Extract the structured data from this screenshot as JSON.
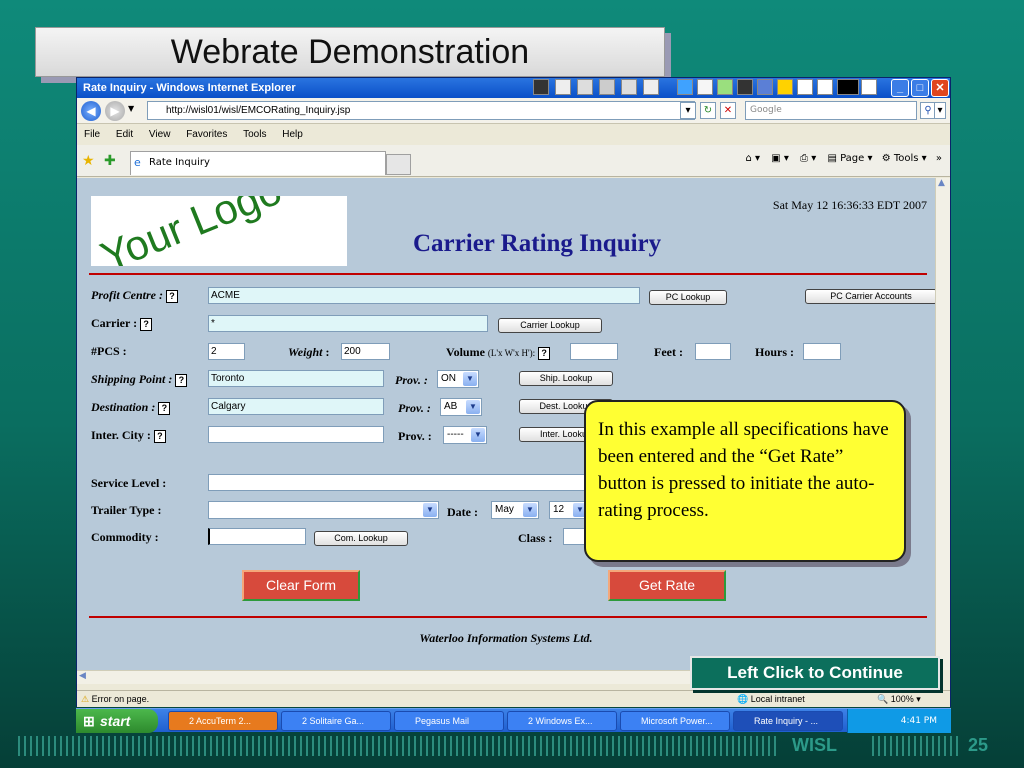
{
  "slide": {
    "title": "Webrate Demonstration",
    "footer_label": "WISL",
    "page_number": "25",
    "continue_label": "Left Click to Continue",
    "callout_text": "In this example all specifications have been entered and the “Get Rate” button is pressed to initiate the auto-rating process."
  },
  "browser": {
    "window_title": "Rate Inquiry - Windows Internet Explorer",
    "url": "http://wisl01/wisl/EMCORating_Inquiry.jsp",
    "search_placeholder": "Google",
    "menu": [
      "File",
      "Edit",
      "View",
      "Favorites",
      "Tools",
      "Help"
    ],
    "tab_label": "Rate Inquiry",
    "page_cmd_label": "Page",
    "tools_cmd_label": "Tools",
    "status_left": "Error on page.",
    "status_zone": "Local intranet",
    "status_zoom": "100%"
  },
  "page": {
    "logo_text": "Your Logo",
    "date": "Sat May 12 16:36:33 EDT 2007",
    "heading": "Carrier Rating Inquiry",
    "footer": "Waterloo Information Systems Ltd.",
    "labels": {
      "profit_centre": "Profit Centre :",
      "carrier": "Carrier :",
      "pcs": "#PCS :",
      "weight": "Weight",
      "volume": "Volume",
      "volume_hint": "(L'x W'x H'):",
      "feet": "Feet :",
      "hours": "Hours :",
      "shipping_point": "Shipping Point :",
      "prov": "Prov. :",
      "destination": "Destination :",
      "inter_city": "Inter. City :",
      "service_level": "Service Level :",
      "trailer_type": "Trailer Type :",
      "date": "Date :",
      "commodity": "Commodity :",
      "class": "Class :",
      "help": "?"
    },
    "values": {
      "profit_centre": "ACME",
      "carrier": "*",
      "pcs": "2",
      "weight": "200",
      "volume": "",
      "feet": "",
      "hours": "",
      "shipping_point": "Toronto",
      "shipping_prov": "ON",
      "destination": "Calgary",
      "destination_prov": "AB",
      "inter_city": "",
      "inter_prov": "-----",
      "service_level": "",
      "trailer_type": "",
      "date_month": "May",
      "date_day": "12",
      "commodity": "",
      "class": ""
    },
    "buttons": {
      "pc_lookup": "PC Lookup",
      "pc_carrier_accounts": "PC Carrier Accounts",
      "carrier_lookup": "Carrier Lookup",
      "ship_lookup": "Ship. Lookup",
      "dest_lookup": "Dest. Lookup",
      "inter_lookup": "Inter. Lookup",
      "com_lookup": "Com. Lookup",
      "clear_form": "Clear Form",
      "get_rate": "Get Rate"
    }
  },
  "taskbar": {
    "start": "start",
    "tasks": [
      "2 AccuTerm 2...",
      "2 Solitaire Ga...",
      "Pegasus Mail",
      "2 Windows Ex...",
      "Microsoft Power...",
      "Rate Inquiry - ..."
    ],
    "clock": "4:41 PM"
  }
}
